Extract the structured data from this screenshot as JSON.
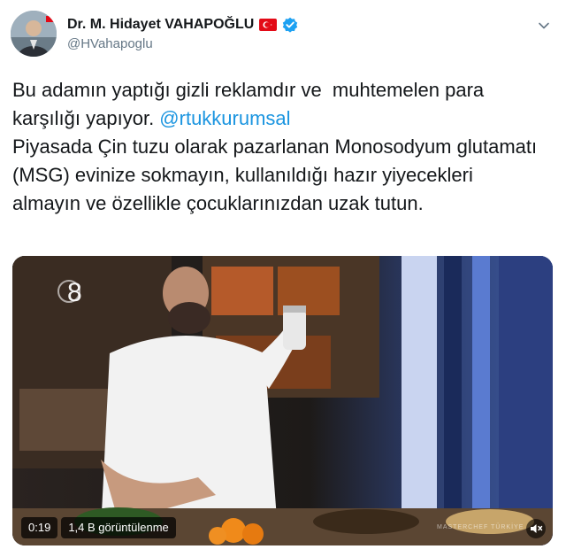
{
  "author": {
    "display_name": "Dr. M. Hidayet VAHAPOĞLU",
    "handle": "@HVahapoglu",
    "flag_icon": "turkey-flag-icon",
    "verified_icon": "verified-badge-icon"
  },
  "tweet": {
    "text_before": "Bu adamın yaptığı gizli reklamdır ve  muhtemelen para karşılığı yapıyor. ",
    "mention": "@rtukkurumsal",
    "text_after": "\nPiyasada Çin tuzu olarak pazarlanan Monosodyum glutamatı (MSG) evinize sokmayın, kullanıldığı hazır yiyecekleri almayın ve özellikle çocuklarınızdan uzak tutun."
  },
  "media": {
    "duration": "0:19",
    "views": "1,4 B görüntülenme",
    "scene_number": "8",
    "watermark": "MASTERCHEF TÜRKİYE"
  },
  "colors": {
    "link": "#1b95e0",
    "verified": "#1da1f2",
    "flag": "#e30a17"
  }
}
